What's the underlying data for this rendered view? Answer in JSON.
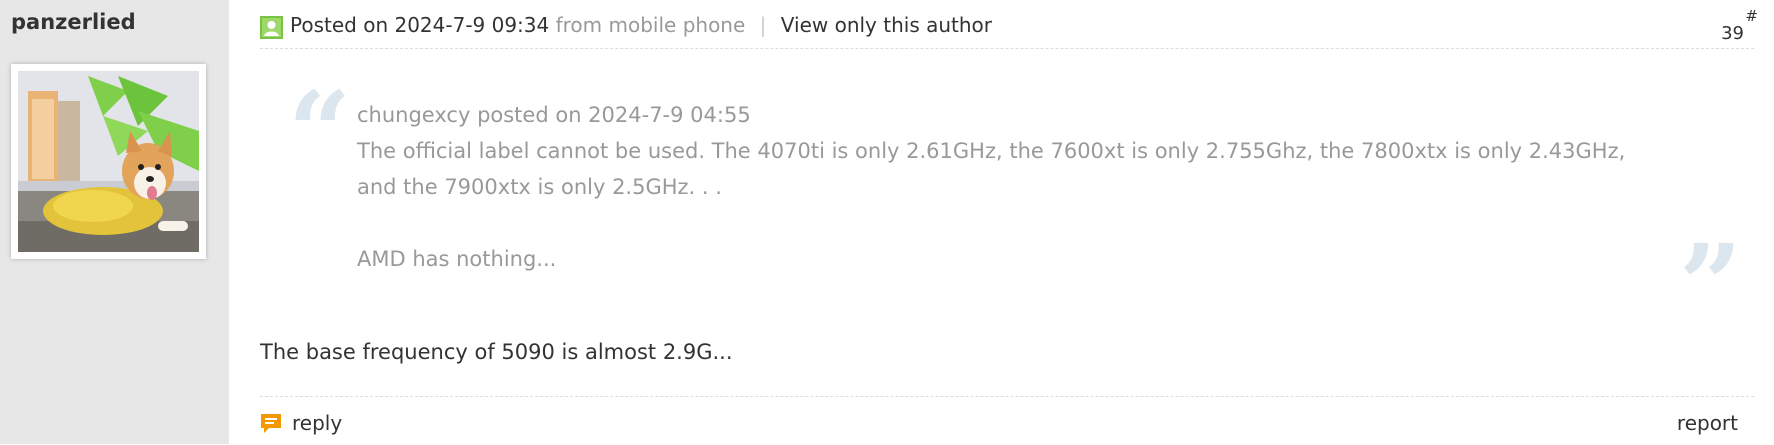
{
  "author": {
    "name": "panzerlied",
    "avatar_icon": "corgi-avatar"
  },
  "header": {
    "status_icon": "user-online-icon",
    "posted": "Posted on 2024-7-9 09:34",
    "from": "from mobile phone",
    "separator": "|",
    "view_only_author": "View only this author",
    "floor_hash": "#",
    "floor_number": "39"
  },
  "quote": {
    "attribution": "chungexcy posted on 2024-7-9 04:55",
    "lines": [
      "The official label cannot be used. The 4070ti is only 2.61GHz, the 7600xt is only 2.755Ghz, the 7800xtx is only 2.43GHz,",
      "and the 7900xtx is only 2.5GHz. . ."
    ],
    "last_line": "AMD has nothing..."
  },
  "message": "The base frequency of 5090 is almost 2.9G...",
  "footer": {
    "reply_icon": "reply-comment-icon",
    "reply_label": "reply",
    "report_label": "report"
  },
  "colors": {
    "sidebar_bg": "#e7e7e7",
    "quote_text": "#999999",
    "quote_mark": "#dbe6ef",
    "reply_icon": "#f39800",
    "status_icon": "#7cc242"
  }
}
